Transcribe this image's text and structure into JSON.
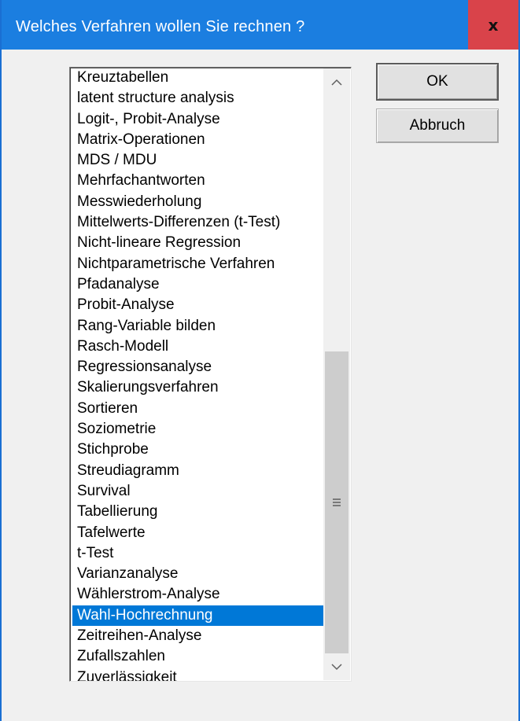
{
  "window": {
    "title": "Welches Verfahren wollen Sie rechnen ?",
    "close_symbol": "x"
  },
  "buttons": {
    "ok_label": "OK",
    "cancel_label": "Abbruch"
  },
  "list": {
    "items": [
      "Kreuztabellen",
      "latent structure analysis",
      "Logit-, Probit-Analyse",
      "Matrix-Operationen",
      "MDS / MDU",
      "Mehrfachantworten",
      "Messwiederholung",
      "Mittelwerts-Differenzen (t-Test)",
      "Nicht-lineare Regression",
      "Nichtparametrische Verfahren",
      "Pfadanalyse",
      "Probit-Analyse",
      "Rang-Variable bilden",
      "Rasch-Modell",
      "Regressionsanalyse",
      "Skalierungsverfahren",
      "Sortieren",
      "Soziometrie",
      "Stichprobe",
      "Streudiagramm",
      "Survival",
      "Tabellierung",
      "Tafelwerte",
      "t-Test",
      "Varianzanalyse",
      "Wählerstrom-Analyse",
      "Wahl-Hochrechnung",
      "Zeitreihen-Analyse",
      "Zufallszahlen",
      "Zuverlässigkeit"
    ],
    "selected_index": 26
  },
  "icons": {
    "scroll_up": "chevron-up-icon",
    "scroll_down": "chevron-down-icon",
    "scroll_grip": "grip-icon"
  },
  "colors": {
    "title_bar": "#1b7ee0",
    "close_button": "#d9434a",
    "selection": "#0078d7"
  }
}
